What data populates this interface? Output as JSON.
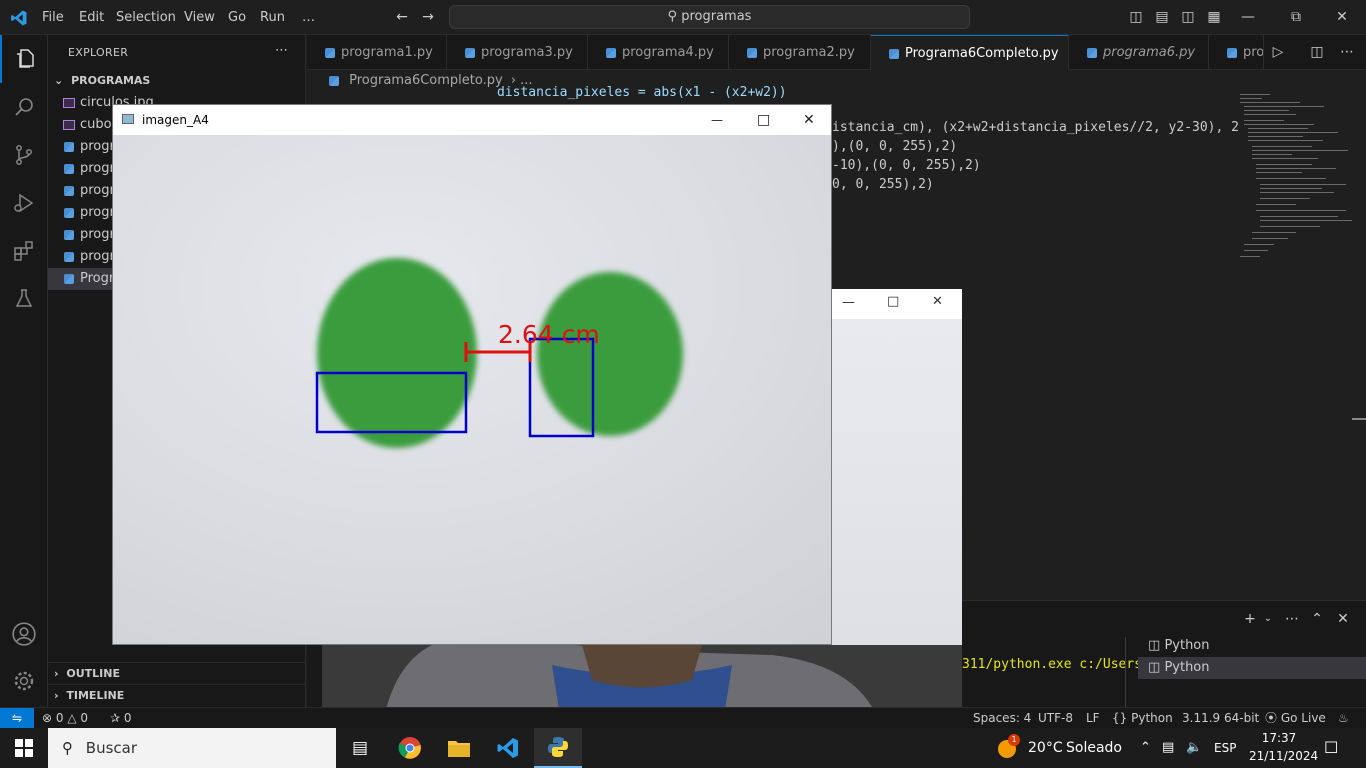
{
  "titlebar": {
    "menu": [
      "File",
      "Edit",
      "Selection",
      "View",
      "Go",
      "Run",
      "…"
    ],
    "search_text": "programas"
  },
  "sidebar": {
    "header": "EXPLORER",
    "folder": "PROGRAMAS",
    "items": [
      {
        "label": "circulos.jpg",
        "type": "image"
      },
      {
        "label": "cubo",
        "type": "image"
      },
      {
        "label": "progr",
        "type": "python"
      },
      {
        "label": "progr",
        "type": "python"
      },
      {
        "label": "progr",
        "type": "python"
      },
      {
        "label": "progr",
        "type": "python"
      },
      {
        "label": "progr",
        "type": "python"
      },
      {
        "label": "progr",
        "type": "python"
      },
      {
        "label": "Progr",
        "type": "python",
        "selected": true
      }
    ],
    "outline": "OUTLINE",
    "timeline": "TIMELINE"
  },
  "tabs": [
    {
      "label": "programa1.py"
    },
    {
      "label": "programa3.py"
    },
    {
      "label": "programa4.py"
    },
    {
      "label": "programa2.py"
    },
    {
      "label": "Programa6Completo.py",
      "active": true
    },
    {
      "label": "programa6.py"
    },
    {
      "label": "prog"
    }
  ],
  "breadcrumbs": {
    "file": "Programa6Completo.py",
    "rest": "..."
  },
  "code": {
    "line0": "distancia_pixeles = abs(x1 - (x2+w2))",
    "line1": "istancia_cm), (x2+w2+distancia_pixeles//2, y2-30), 2",
    "line2": "),(0, 0, 255),2)",
    "line3": "-10),(0, 0, 255),2)",
    "line4": "0, 0, 255),2)"
  },
  "panel": {
    "terminal_text": "311/python.exe c:/Users",
    "terminals": [
      "Python",
      "Python"
    ]
  },
  "statusbar": {
    "errors": "0",
    "warnings": "0",
    "ports": "0",
    "spaces": "Spaces: 4",
    "encoding": "UTF-8",
    "eol": "LF",
    "language": "Python",
    "interpreter": "3.11.9 64-bit",
    "golive": "Go Live"
  },
  "taskbar": {
    "search": "Buscar",
    "weather_temp": "20°C",
    "weather_desc": "Soleado",
    "lang": "ESP",
    "time": "17:37",
    "date": "21/11/2024",
    "notification_badge": "1"
  },
  "image_window": {
    "title": "imagen_A4",
    "measurement": "2.64 cm",
    "box_color": "#0000cc",
    "measure_color": "#e01010",
    "circle_color": "#3a9c3e"
  }
}
